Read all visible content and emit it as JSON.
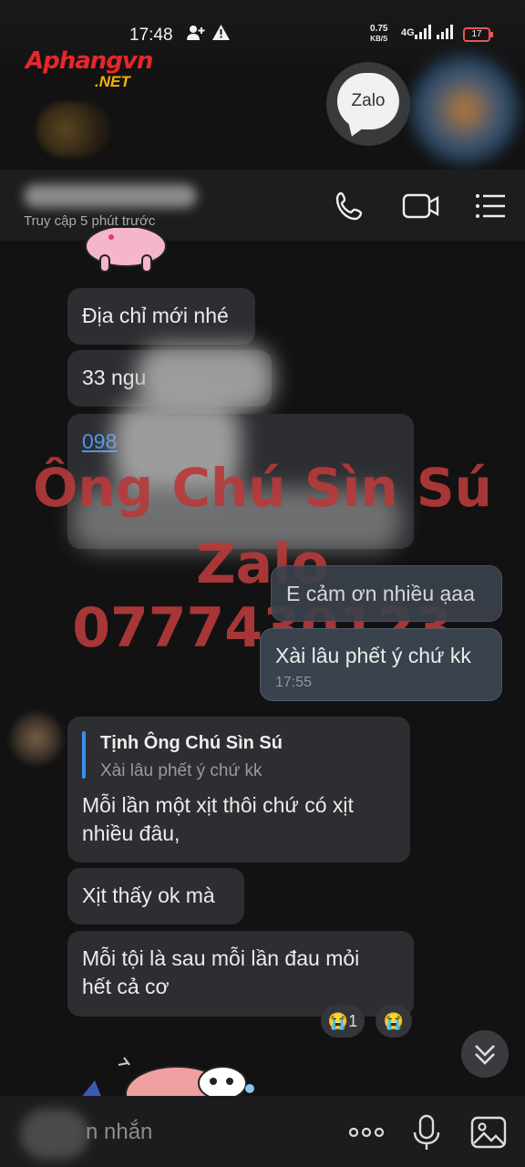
{
  "status_bar": {
    "time": "17:48",
    "net_speed_value": "0.75",
    "net_speed_unit": "KB/S",
    "network_type": "4G",
    "battery": "17"
  },
  "logo": {
    "main": "Aphangvn",
    "sub": ".NET"
  },
  "zalo_badge": {
    "label": "Zalo"
  },
  "header": {
    "last_seen": "Truy cập 5 phút trước",
    "icons": [
      "phone-icon",
      "video-camera-icon",
      "menu-icon"
    ]
  },
  "messages": {
    "m1": {
      "text": "Địa chỉ mới nhé"
    },
    "m2": {
      "text": "33 ngu"
    },
    "m3": {
      "text": "098"
    },
    "m4": {
      "text": "E cảm ơn nhiều ạaa"
    },
    "m5": {
      "text": "Xài lâu phết ý chứ kk",
      "time": "17:55"
    },
    "m6": {
      "reply_name": "Tịnh Ông Chú Sìn Sú",
      "reply_text": "Xài lâu phết ý chứ kk",
      "text_line1": "Mỗi lần một xịt thôi chứ có xịt",
      "text_line2": "nhiều đâu,"
    },
    "m7": {
      "text": "Xịt thấy ok mà"
    },
    "m8": {
      "text_line1": "Mỗi tội là sau mỗi lần đau mỏi",
      "text_line2": "hết cả cơ"
    }
  },
  "reactions": {
    "count": "1",
    "emoji": "😭",
    "add_emoji": "😭"
  },
  "watermark": {
    "line1": "Ông Chú Sìn Sú",
    "line2": "Zalo 0777430123",
    "color": "#b83a3a"
  },
  "composer": {
    "placeholder": "n nhắn",
    "icons": [
      "more-icon",
      "microphone-icon",
      "image-icon"
    ]
  },
  "colors": {
    "accent": "#3b8cf0",
    "link": "#4a95e8",
    "incoming_bubble": "#2d2e31",
    "outgoing_bubble": "#3a424d"
  }
}
